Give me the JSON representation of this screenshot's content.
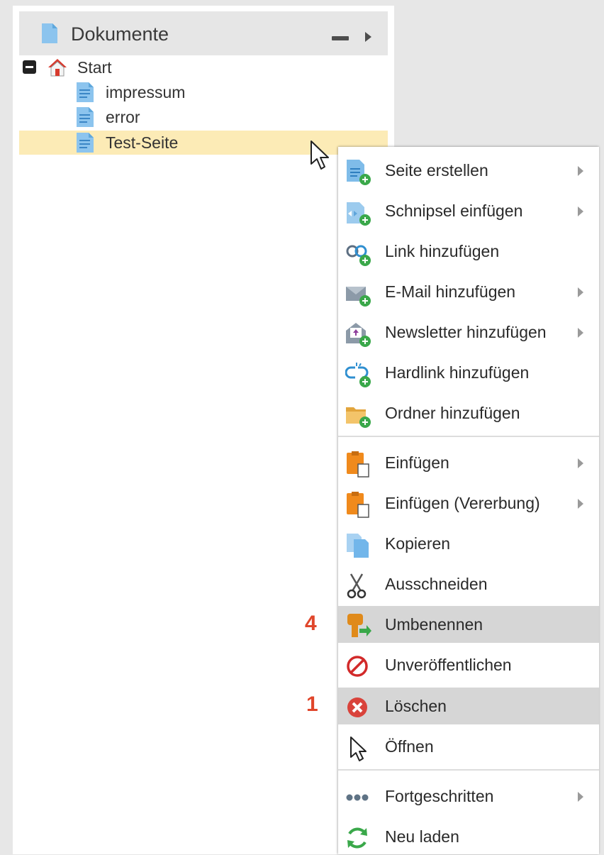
{
  "panel": {
    "title": "Dokumente",
    "icons": {
      "title": "document-icon",
      "collapse": "minimize-icon",
      "expand": "chevron-right-icon"
    }
  },
  "tree": {
    "root": {
      "label": "Start",
      "icon": "home-icon",
      "toggle_icon": "collapse-minus-icon"
    },
    "children": [
      {
        "label": "impressum",
        "icon": "page-icon",
        "selected": false
      },
      {
        "label": "error",
        "icon": "page-icon",
        "selected": false
      },
      {
        "label": "Test-Seite",
        "icon": "page-icon",
        "selected": true
      }
    ]
  },
  "context_menu": {
    "items": [
      {
        "label": "Seite erstellen",
        "icon": "page-add-icon",
        "submenu": true
      },
      {
        "label": "Schnipsel einfügen",
        "icon": "snippet-add-icon",
        "submenu": true
      },
      {
        "label": "Link hinzufügen",
        "icon": "link-add-icon",
        "submenu": false
      },
      {
        "label": "E-Mail hinzufügen",
        "icon": "email-add-icon",
        "submenu": true
      },
      {
        "label": "Newsletter hinzufügen",
        "icon": "newsletter-add-icon",
        "submenu": true
      },
      {
        "label": "Hardlink hinzufügen",
        "icon": "hardlink-add-icon",
        "submenu": false
      },
      {
        "label": "Ordner hinzufügen",
        "icon": "folder-add-icon",
        "submenu": false
      },
      {
        "label": "Einfügen",
        "icon": "paste-icon",
        "submenu": true
      },
      {
        "label": "Einfügen (Vererbung)",
        "icon": "paste-inheritance-icon",
        "submenu": true
      },
      {
        "label": "Kopieren",
        "icon": "copy-icon",
        "submenu": false
      },
      {
        "label": "Ausschneiden",
        "icon": "scissors-icon",
        "submenu": false
      },
      {
        "label": "Umbenennen",
        "icon": "rename-key-icon",
        "submenu": false,
        "highlighted": true
      },
      {
        "label": "Unveröffentlichen",
        "icon": "unpublish-icon",
        "submenu": false
      },
      {
        "label": "Löschen",
        "icon": "delete-icon",
        "submenu": false,
        "highlighted": true
      },
      {
        "label": "Öffnen",
        "icon": "open-cursor-icon",
        "submenu": false
      },
      {
        "label": "Fortgeschritten",
        "icon": "more-dots-icon",
        "submenu": true
      },
      {
        "label": "Neu laden",
        "icon": "reload-icon",
        "submenu": false
      }
    ]
  },
  "annotations": {
    "rename_step": "4",
    "delete_step": "1"
  },
  "colors": {
    "selected_row": "#fcebb6",
    "highlighted_item": "#d6d6d6",
    "annotation": "#e0462b"
  }
}
